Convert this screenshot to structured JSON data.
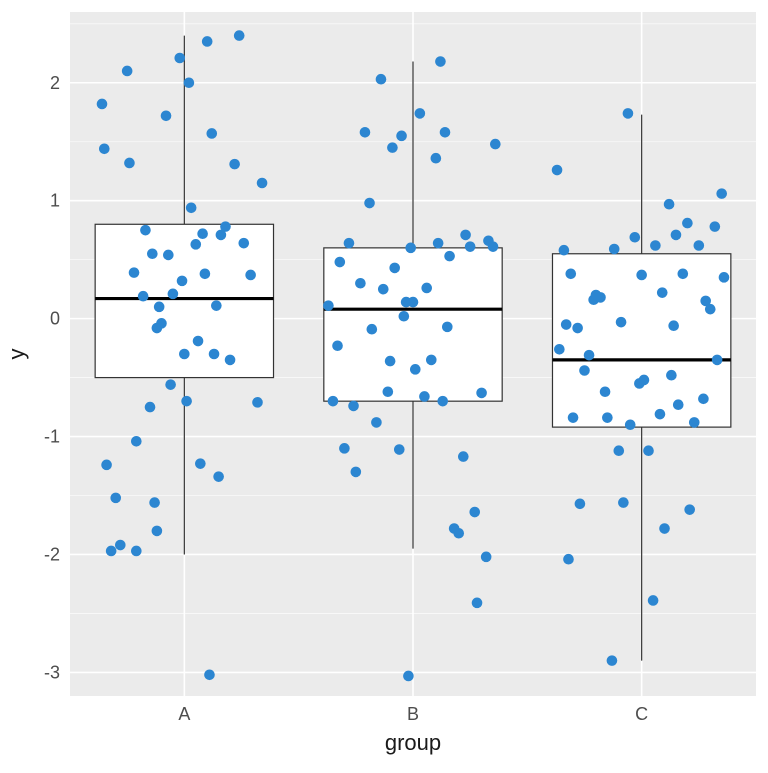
{
  "chart_data": {
    "type": "boxplot+jitter",
    "xlabel": "group",
    "ylabel": "y",
    "categories": [
      "A",
      "B",
      "C"
    ],
    "y_ticks": [
      -3,
      -2,
      -1,
      0,
      1,
      2
    ],
    "ylim": [
      -3.2,
      2.6
    ],
    "box_stats": [
      {
        "name": "A",
        "min": -2.0,
        "q1": -0.5,
        "median": 0.17,
        "q3": 0.8,
        "max": 2.4
      },
      {
        "name": "B",
        "min": -1.95,
        "q1": -0.7,
        "median": 0.08,
        "q3": 0.6,
        "max": 2.18
      },
      {
        "name": "C",
        "min": -2.9,
        "q1": -0.92,
        "median": -0.35,
        "q3": 0.55,
        "max": 1.73
      }
    ],
    "jitter": {
      "A": [
        [
          -0.36,
          1.82
        ],
        [
          -0.35,
          1.44
        ],
        [
          -0.34,
          -1.24
        ],
        [
          -0.32,
          -1.97
        ],
        [
          -0.3,
          -1.52
        ],
        [
          -0.28,
          -1.92
        ],
        [
          -0.25,
          2.1
        ],
        [
          -0.24,
          1.32
        ],
        [
          -0.22,
          0.39
        ],
        [
          -0.21,
          -1.04
        ],
        [
          -0.21,
          -1.97
        ],
        [
          -0.18,
          0.19
        ],
        [
          -0.17,
          0.75
        ],
        [
          -0.15,
          -0.75
        ],
        [
          -0.14,
          0.55
        ],
        [
          -0.13,
          -1.56
        ],
        [
          -0.12,
          -0.08
        ],
        [
          -0.12,
          -1.8
        ],
        [
          -0.11,
          0.1
        ],
        [
          -0.1,
          -0.04
        ],
        [
          -0.08,
          1.72
        ],
        [
          -0.07,
          0.54
        ],
        [
          -0.06,
          -0.56
        ],
        [
          -0.05,
          0.21
        ],
        [
          -0.02,
          2.21
        ],
        [
          -0.01,
          0.32
        ],
        [
          0.0,
          -0.3
        ],
        [
          0.01,
          -0.7
        ],
        [
          0.02,
          2.0
        ],
        [
          0.03,
          0.94
        ],
        [
          0.05,
          0.63
        ],
        [
          0.06,
          -0.19
        ],
        [
          0.07,
          -1.23
        ],
        [
          0.08,
          0.72
        ],
        [
          0.09,
          0.38
        ],
        [
          0.1,
          2.35
        ],
        [
          0.11,
          -3.02
        ],
        [
          0.12,
          1.57
        ],
        [
          0.13,
          -0.3
        ],
        [
          0.14,
          0.11
        ],
        [
          0.15,
          -1.34
        ],
        [
          0.16,
          0.71
        ],
        [
          0.18,
          0.78
        ],
        [
          0.2,
          -0.35
        ],
        [
          0.22,
          1.31
        ],
        [
          0.24,
          2.4
        ],
        [
          0.26,
          0.64
        ],
        [
          0.29,
          0.37
        ],
        [
          0.32,
          -0.71
        ],
        [
          0.34,
          1.15
        ]
      ],
      "B": [
        [
          -0.37,
          0.11
        ],
        [
          -0.35,
          -0.7
        ],
        [
          -0.33,
          -0.23
        ],
        [
          -0.32,
          0.48
        ],
        [
          -0.3,
          -1.1
        ],
        [
          -0.28,
          0.64
        ],
        [
          -0.26,
          -0.74
        ],
        [
          -0.25,
          -1.3
        ],
        [
          -0.23,
          0.3
        ],
        [
          -0.21,
          1.58
        ],
        [
          -0.19,
          0.98
        ],
        [
          -0.18,
          -0.09
        ],
        [
          -0.16,
          -0.88
        ],
        [
          -0.14,
          2.03
        ],
        [
          -0.13,
          0.25
        ],
        [
          -0.11,
          -0.62
        ],
        [
          -0.1,
          -0.36
        ],
        [
          -0.09,
          1.45
        ],
        [
          -0.08,
          0.43
        ],
        [
          -0.06,
          -1.11
        ],
        [
          -0.05,
          1.55
        ],
        [
          -0.03,
          0.14
        ],
        [
          -0.02,
          -3.03
        ],
        [
          -0.01,
          0.6
        ],
        [
          0.0,
          0.14
        ],
        [
          0.01,
          -0.43
        ],
        [
          0.03,
          1.74
        ],
        [
          0.05,
          -0.66
        ],
        [
          0.06,
          0.26
        ],
        [
          0.08,
          -0.35
        ],
        [
          0.1,
          1.36
        ],
        [
          0.11,
          0.64
        ],
        [
          0.12,
          2.18
        ],
        [
          0.13,
          -0.7
        ],
        [
          0.14,
          1.58
        ],
        [
          0.16,
          0.53
        ],
        [
          0.18,
          -1.78
        ],
        [
          0.2,
          -1.82
        ],
        [
          0.22,
          -1.17
        ],
        [
          0.23,
          0.71
        ],
        [
          0.25,
          0.61
        ],
        [
          0.27,
          -1.64
        ],
        [
          0.28,
          -2.41
        ],
        [
          0.3,
          -0.63
        ],
        [
          0.32,
          -2.02
        ],
        [
          0.33,
          0.66
        ],
        [
          0.35,
          0.61
        ],
        [
          0.36,
          1.48
        ],
        [
          -0.04,
          0.02
        ],
        [
          0.15,
          -0.07
        ]
      ],
      "C": [
        [
          -0.37,
          1.26
        ],
        [
          -0.36,
          -0.26
        ],
        [
          -0.34,
          0.58
        ],
        [
          -0.33,
          -0.05
        ],
        [
          -0.32,
          -2.04
        ],
        [
          -0.3,
          -0.84
        ],
        [
          -0.28,
          -0.08
        ],
        [
          -0.27,
          -1.57
        ],
        [
          -0.25,
          -0.44
        ],
        [
          -0.23,
          -0.31
        ],
        [
          -0.21,
          0.16
        ],
        [
          -0.2,
          0.2
        ],
        [
          -0.18,
          0.18
        ],
        [
          -0.16,
          -0.62
        ],
        [
          -0.15,
          -0.84
        ],
        [
          -0.13,
          -2.9
        ],
        [
          -0.12,
          0.59
        ],
        [
          -0.1,
          -1.12
        ],
        [
          -0.08,
          -1.56
        ],
        [
          -0.06,
          1.74
        ],
        [
          -0.05,
          -0.9
        ],
        [
          -0.03,
          0.69
        ],
        [
          -0.01,
          -0.55
        ],
        [
          0.0,
          0.37
        ],
        [
          0.01,
          -0.52
        ],
        [
          0.03,
          -1.12
        ],
        [
          0.05,
          -2.39
        ],
        [
          0.06,
          0.62
        ],
        [
          0.08,
          -0.81
        ],
        [
          0.09,
          0.22
        ],
        [
          0.1,
          -1.78
        ],
        [
          0.12,
          0.97
        ],
        [
          0.13,
          -0.48
        ],
        [
          0.15,
          0.71
        ],
        [
          0.16,
          -0.73
        ],
        [
          0.18,
          0.38
        ],
        [
          0.2,
          0.81
        ],
        [
          0.21,
          -1.62
        ],
        [
          0.23,
          -0.88
        ],
        [
          0.25,
          0.62
        ],
        [
          0.27,
          -0.68
        ],
        [
          0.28,
          0.15
        ],
        [
          0.3,
          0.08
        ],
        [
          0.32,
          0.78
        ],
        [
          0.33,
          -0.35
        ],
        [
          0.35,
          1.06
        ],
        [
          -0.31,
          0.38
        ],
        [
          0.14,
          -0.06
        ],
        [
          0.36,
          0.35
        ],
        [
          -0.09,
          -0.03
        ]
      ]
    },
    "point_color": "#2c86d1",
    "panel_bg": "#ebebeb"
  }
}
